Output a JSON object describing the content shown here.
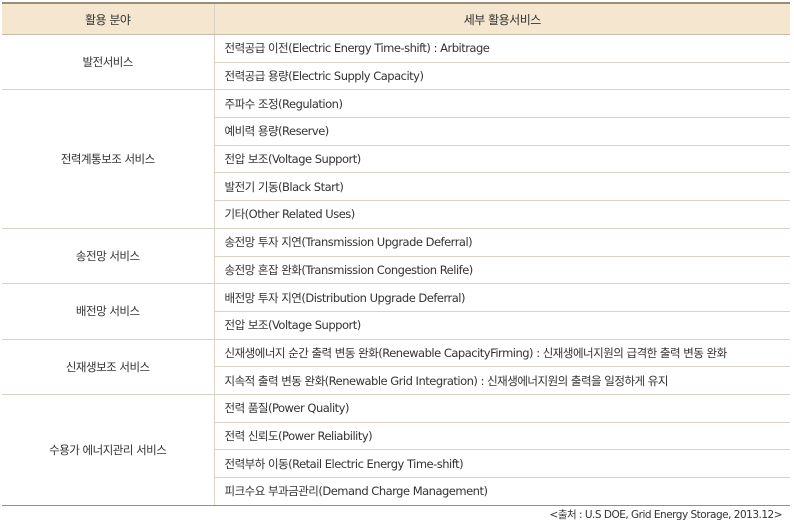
{
  "header": {
    "col1": "활용 분야",
    "col2": "세부 활용서비스"
  },
  "rows": [
    {
      "category": "발전서비스",
      "items": [
        "전력공급 이전(Electric Energy Time-shift) : Arbitrage",
        "전력공급 용량(Electric Supply Capacity)"
      ]
    },
    {
      "category": "전력계통보조 서비스",
      "items": [
        "주파수 조정(Regulation)",
        "예비력 용량(Reserve)",
        "전압 보조(Voltage Support)",
        "발전기 기동(Black Start)",
        "기타(Other Related Uses)"
      ]
    },
    {
      "category": "송전망 서비스",
      "items": [
        "송전망 투자 지연(Transmission Upgrade Deferral)",
        "송전망 혼잡 완화(Transmission Congestion Relife)"
      ]
    },
    {
      "category": "배전망 서비스",
      "items": [
        "배전망 투자 지연(Distribution Upgrade Deferral)",
        "전압 보조(Voltage Support)"
      ]
    },
    {
      "category": "신재생보조 서비스",
      "items": [
        "신재생에너지 순간 출력 변동 완화(Renewable CapacityFirming) : 신재생에너지원의 급격한 출력 변동 완화",
        "지속적 출력 변동 완화(Renewable Grid Integration) : 신재생에너지원의 출력을 일정하게 유지"
      ]
    },
    {
      "category": "수용가 에너지관리 서비스",
      "items": [
        "전력 품질(Power Quality)",
        "전력 신뢰도(Power Reliability)",
        "전력부하 이동(Retail Electric Energy Time-shift)",
        "피크수요 부과금관리(Demand Charge Management)"
      ]
    }
  ],
  "source": "<출처 : U.S DOE, Grid Energy Storage, 2013.12>"
}
